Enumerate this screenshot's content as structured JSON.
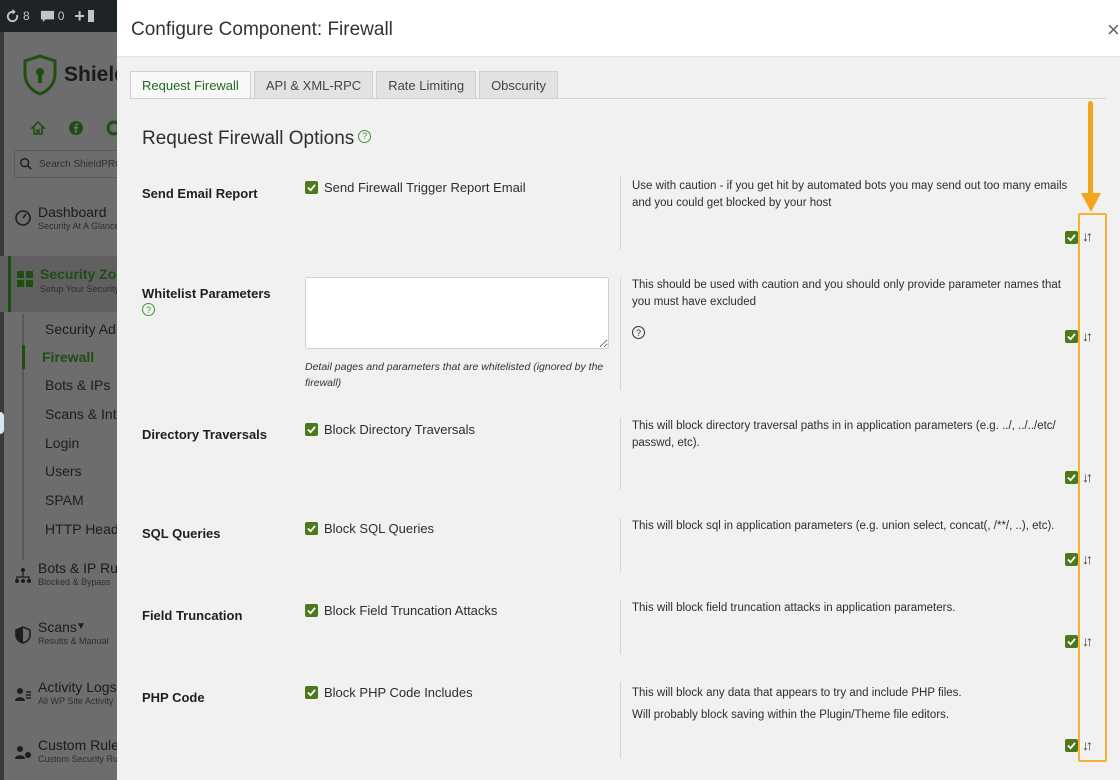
{
  "adminbar": {
    "updates_count": "8",
    "comments_count": "0"
  },
  "sidebar": {
    "logo_text": "Shield",
    "search_placeholder": "Search ShieldPRO",
    "nav": [
      {
        "title": "Dashboard",
        "subtitle": "Security At A Glance",
        "icon": "gauge-icon"
      },
      {
        "title": "Security Zones",
        "subtitle": "Setup Your Security",
        "icon": "grid-icon"
      },
      {
        "title": "Bots & IP Rules",
        "subtitle": "Blocked & Bypass",
        "icon": "network-icon"
      },
      {
        "title": "Scans",
        "subtitle": "Results & Manual",
        "icon": "shield-half-icon"
      },
      {
        "title": "Activity Logs",
        "subtitle": "All WP Site Activity",
        "icon": "users-icon"
      },
      {
        "title": "Custom Rules",
        "subtitle": "Custom Security Rules",
        "icon": "rules-icon"
      }
    ],
    "subnav": [
      "Security Admin",
      "Firewall",
      "Bots & IPs",
      "Scans & Integrity",
      "Login",
      "Users",
      "SPAM",
      "HTTP Headers"
    ]
  },
  "modal": {
    "title": "Configure Component: Firewall",
    "close_label": "×",
    "tabs": [
      "Request Firewall",
      "API & XML-RPC",
      "Rate Limiting",
      "Obscurity"
    ],
    "section_title": "Request Firewall Options"
  },
  "options": [
    {
      "label": "Send Email Report",
      "checkbox_label": "Send Firewall Trigger Report Email",
      "desc": [
        "Use with caution - if you get hit by automated bots you may send out too many emails",
        "and you could get blocked by your host"
      ]
    },
    {
      "label": "Whitelist Parameters",
      "input_value": "",
      "help": "Detail pages and parameters that are whitelisted (ignored by the firewall)",
      "desc": [
        "This should be used with caution and you should only provide parameter names that",
        "you must have excluded"
      ]
    },
    {
      "label": "Directory Traversals",
      "checkbox_label": "Block Directory Traversals",
      "desc": [
        "This will block directory traversal paths in in application parameters (e.g. ../, ../../etc/",
        "passwd, etc)."
      ]
    },
    {
      "label": "SQL Queries",
      "checkbox_label": "Block SQL Queries",
      "desc": [
        "This will block sql in application parameters (e.g. union select, concat(, /**/, ..), etc)."
      ]
    },
    {
      "label": "Field Truncation",
      "checkbox_label": "Block Field Truncation Attacks",
      "desc": [
        "This will block field truncation attacks in application parameters."
      ]
    },
    {
      "label": "PHP Code",
      "checkbox_label": "Block PHP Code Includes",
      "desc": [
        "This will block any data that appears to try and include PHP files.",
        "Will probably block saving within the Plugin/Theme file editors."
      ]
    }
  ],
  "colors": {
    "accent_green": "#4c7a1b",
    "tab_active_text": "#1f6b1a",
    "annotation_orange": "#f5b331"
  }
}
